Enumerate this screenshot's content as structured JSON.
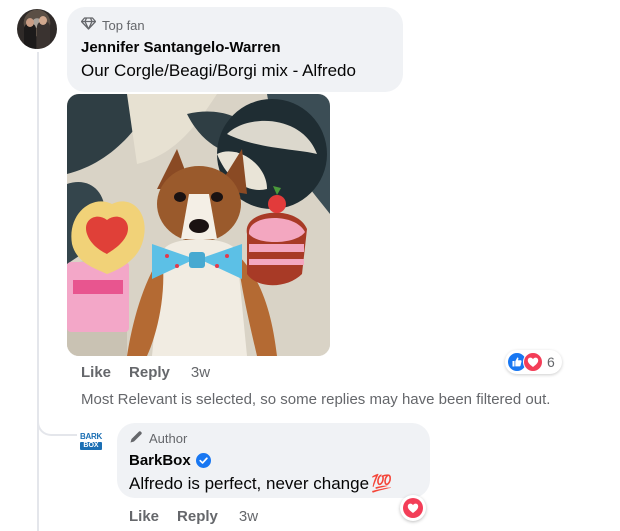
{
  "comment": {
    "badge": "Top fan",
    "author": "Jennifer Santangelo-Warren",
    "text": "Our Corgle/Beagi/Borgi mix - Alfredo",
    "actions": {
      "like": "Like",
      "reply": "Reply",
      "time": "3w"
    },
    "reaction_count": "6"
  },
  "filter_note": "Most Relevant is selected, so some replies may have been filtered out.",
  "reply": {
    "badge": "Author",
    "author": "BarkBox",
    "text": "Alfredo is perfect, never change",
    "emoji": "💯",
    "avatar_text_top": "BARK",
    "avatar_text_bottom": "BOX",
    "actions": {
      "like": "Like",
      "reply": "Reply",
      "time": "3w"
    }
  },
  "colors": {
    "bubble": "#f0f2f5",
    "secondary_text": "#65676b",
    "like_blue": "#1877f2",
    "love_red": "#f33e58",
    "verified": "#1877f2"
  },
  "icons": [
    "diamond-icon",
    "pen-icon",
    "verified-icon",
    "like-reaction-icon",
    "love-reaction-icon"
  ]
}
